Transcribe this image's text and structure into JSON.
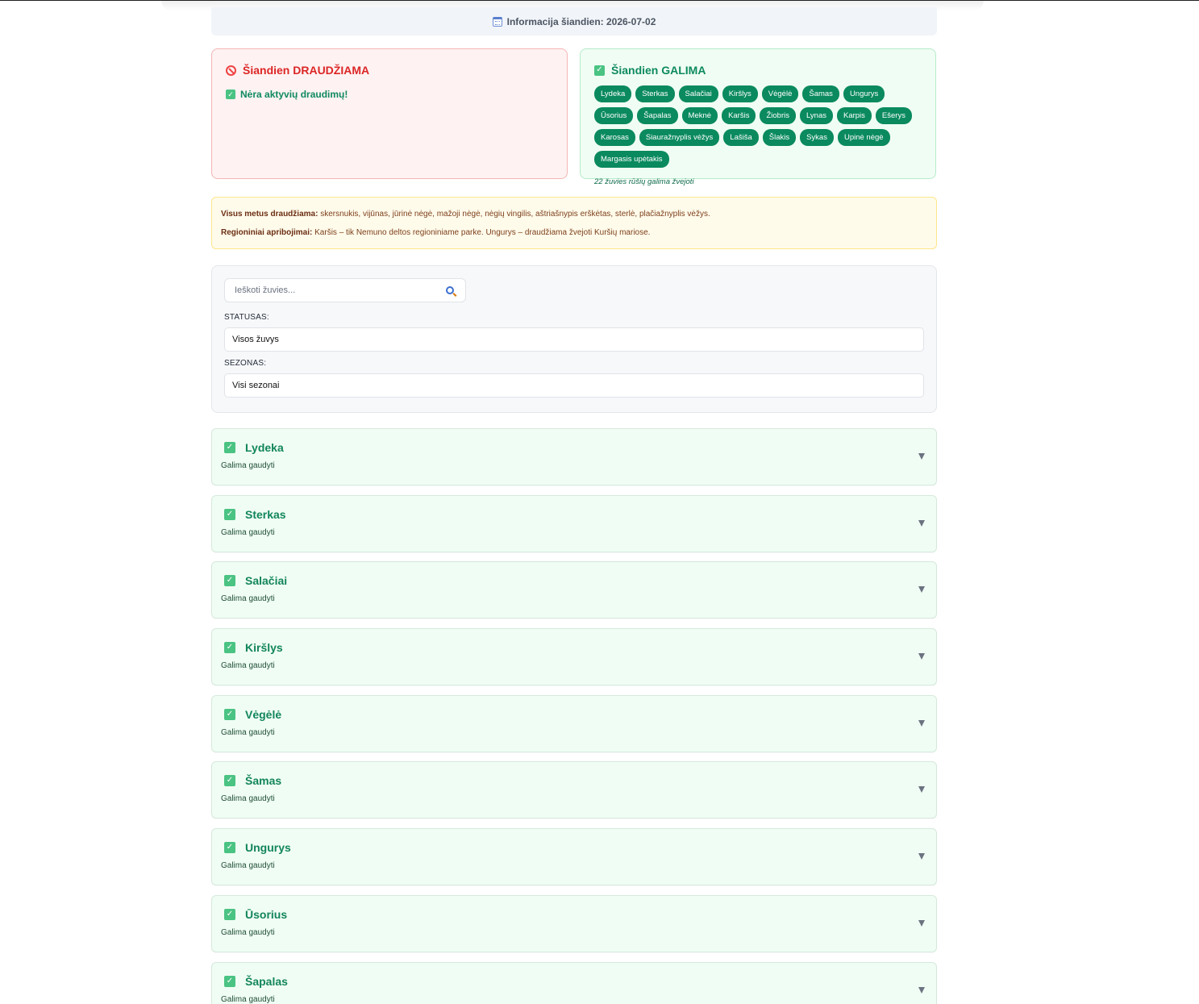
{
  "info_bar": {
    "label": "Informacija šiandien: 2026-07-02"
  },
  "prohibited_card": {
    "title": "Šiandien DRAUDŽIAMA",
    "empty_message": "Nėra aktyvių draudimų!"
  },
  "allowed_card": {
    "title": "Šiandien GALIMA",
    "tags": [
      "Lydeka",
      "Sterkas",
      "Salačiai",
      "Kiršlys",
      "Vėgėlė",
      "Šamas",
      "Ungurys",
      "Ūsorius",
      "Šapalas",
      "Meknė",
      "Karšis",
      "Žiobris",
      "Lynas",
      "Karpis",
      "Ešerys",
      "Karosas",
      "Siauražnyplis vėžys",
      "Lašiša",
      "Šlakis",
      "Sykas",
      "Upinė nėgė",
      "Margasis upėtakis"
    ],
    "count_note": "22 žuvies rūšių galima žvejoti"
  },
  "notice": {
    "yearround_label": "Visus metus draudžiama:",
    "yearround_text": " skersnukis, vijūnas, jūrinė nėgė, mažoji nėgė, nėgių vingilis, aštriašnypis erškėtas, sterlė, plačiažnyplis vėžys.",
    "regional_label": "Regioniniai apribojimai:",
    "regional_text": " Karšis – tik Nemuno deltos regioniniame parke. Ungurys – draudžiama žvejoti Kuršių mariose."
  },
  "filters": {
    "search_placeholder": "Ieškoti žuvies...",
    "status_label": "STATUSAS:",
    "status_value": "Visos žuvys",
    "season_label": "SEZONAS:",
    "season_value": "Visi sezonai"
  },
  "fish_list": [
    {
      "name": "Lydeka",
      "status": "Galima gaudyti"
    },
    {
      "name": "Sterkas",
      "status": "Galima gaudyti"
    },
    {
      "name": "Salačiai",
      "status": "Galima gaudyti"
    },
    {
      "name": "Kiršlys",
      "status": "Galima gaudyti"
    },
    {
      "name": "Vėgėlė",
      "status": "Galima gaudyti"
    },
    {
      "name": "Šamas",
      "status": "Galima gaudyti"
    },
    {
      "name": "Ungurys",
      "status": "Galima gaudyti"
    },
    {
      "name": "Ūsorius",
      "status": "Galima gaudyti"
    },
    {
      "name": "Šapalas",
      "status": "Galima gaudyti"
    }
  ],
  "icons": {
    "info": "calendar-icon",
    "prohibited": "ban-icon",
    "allowed": "check-icon",
    "search": "search-icon",
    "expand": "chevron-down-icon"
  },
  "colors": {
    "allowed_green": "#0a8a5e",
    "prohibited_red": "#dc2626",
    "notice_bg": "#fffbeb"
  }
}
